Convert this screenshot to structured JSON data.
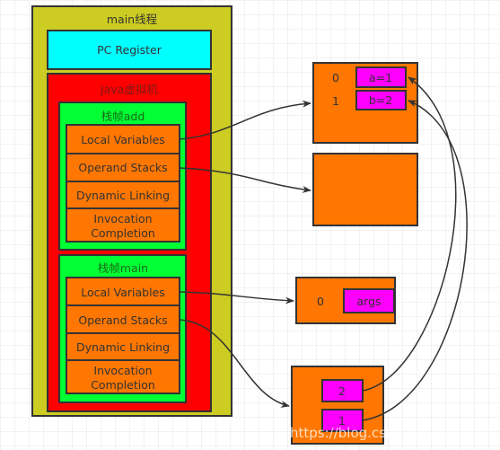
{
  "thread": {
    "title": "main线程",
    "pc_register": "PC Register",
    "jvm_title": "Java虚拟机"
  },
  "frames": [
    {
      "title": "栈帧add",
      "rows": [
        "Local Variables",
        "Operand Stacks",
        "Dynamic Linking",
        "Invocation",
        "Completion"
      ]
    },
    {
      "title": "栈帧main",
      "rows": [
        "Local Variables",
        "Operand Stacks",
        "Dynamic Linking",
        "Invocation",
        "Completion"
      ]
    }
  ],
  "add_locals": {
    "indices": [
      "0",
      "1"
    ],
    "values": [
      "a=1",
      "b=2"
    ]
  },
  "main_locals": {
    "index": "0",
    "value": "args"
  },
  "main_stack": {
    "values": [
      "2",
      "1"
    ]
  },
  "watermark": "https://blog.csdn.net/zwx900102",
  "colors": {
    "thread": "#CCCC22",
    "pc": "#00FFFF",
    "jvm": "#FF0000",
    "frame": "#00FF33",
    "slot": "#FF7700",
    "value": "#FF00FF"
  }
}
